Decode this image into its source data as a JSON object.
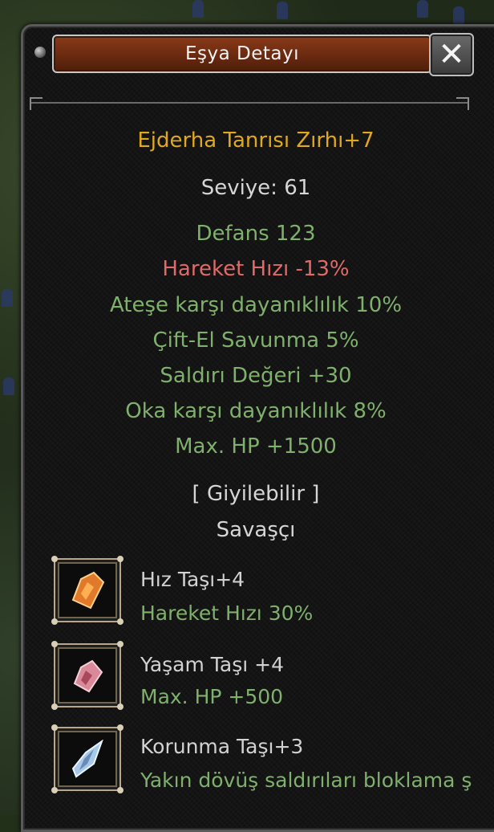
{
  "window": {
    "title": "Eşya Detayı",
    "close_label": "✕"
  },
  "item": {
    "name": "Ejderha Tanrısı Zırhı+7",
    "level": "Seviye: 61",
    "stats": [
      {
        "text": "Defans 123",
        "color": "green"
      },
      {
        "text": "Hareket Hızı -13%",
        "color": "red"
      },
      {
        "text": "Ateşe karşı dayanıklılık 10%",
        "color": "green"
      },
      {
        "text": "Çift-El Savunma 5%",
        "color": "green"
      },
      {
        "text": "Saldırı Değeri +30",
        "color": "green"
      },
      {
        "text": "Oka karşı dayanıklılık 8%",
        "color": "green"
      },
      {
        "text": "Max. HP +1500",
        "color": "green"
      }
    ],
    "wearable": "[ Giyilebilir ]",
    "class": "Savaşçı"
  },
  "stones": [
    {
      "name": "Hız Taşı+4",
      "effect": "Hareket Hızı 30%",
      "icon": "speed-stone-icon",
      "color": "#e07a2a"
    },
    {
      "name": "Yaşam Taşı +4",
      "effect": "Max. HP +500",
      "icon": "life-stone-icon",
      "color": "#d98a9a"
    },
    {
      "name": "Korunma Taşı+3",
      "effect": "Yakın dövüş saldırıları bloklama ş",
      "icon": "protection-stone-icon",
      "color": "#a8c8e8"
    }
  ],
  "colors": {
    "title_gold": "#e0a81e",
    "stat_green": "#7fb06c",
    "stat_red": "#e06a6a",
    "text_white": "#d6d6d6"
  }
}
